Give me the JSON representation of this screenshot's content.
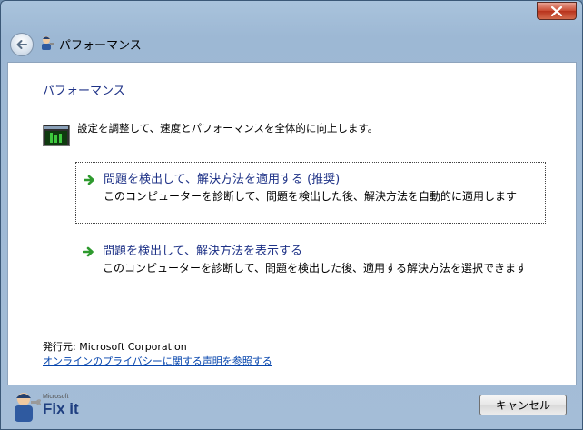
{
  "window": {
    "title": "パフォーマンス"
  },
  "content": {
    "heading": "パフォーマンス",
    "description": "設定を調整して、速度とパフォーマンスを全体的に向上します。",
    "options": [
      {
        "title": "問題を検出して、解決方法を適用する (推奨)",
        "subtitle": "このコンピューターを診断して、問題を検出した後、解決方法を自動的に適用します"
      },
      {
        "title": "問題を検出して、解決方法を表示する",
        "subtitle": "このコンピューターを診断して、問題を検出した後、適用する解決方法を選択できます"
      }
    ],
    "publisher": "発行元: Microsoft Corporation",
    "privacy_link": "オンラインのプライバシーに関する声明を参照する"
  },
  "footer": {
    "logo_brand": "Microsoft",
    "logo_text": "Fix it",
    "cancel_label": "キャンセル"
  },
  "colors": {
    "link_blue": "#1e3287",
    "hyperlink": "#0645ad",
    "arrow_green": "#2e9a2e",
    "close_red": "#c94a31"
  }
}
